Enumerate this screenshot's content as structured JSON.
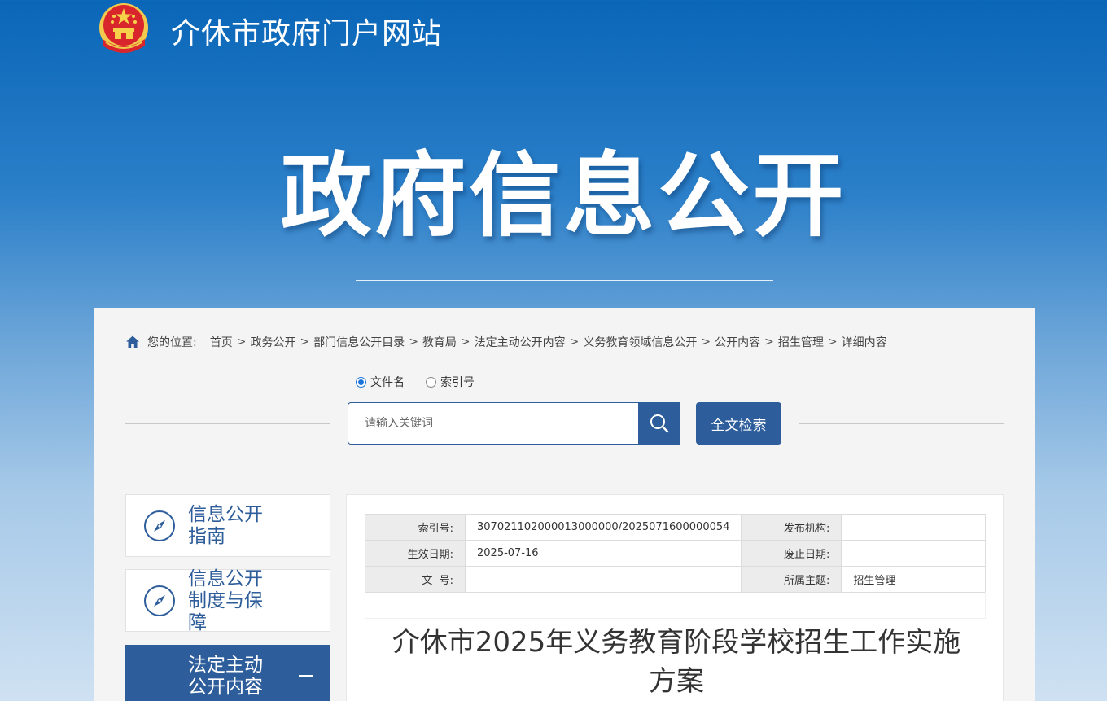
{
  "header": {
    "site_title": "介休市政府门户网站",
    "banner_title": "政府信息公开",
    "emblem_icon": "national-emblem-icon"
  },
  "breadcrumb": {
    "prefix": "您的位置:",
    "items": [
      "首页",
      "政务公开",
      "部门信息公开目录",
      "教育局",
      "法定主动公开内容",
      "义务教育领域信息公开",
      "公开内容",
      "招生管理",
      "详细内容"
    ]
  },
  "search": {
    "radio_options": [
      {
        "label": "文件名",
        "checked": true
      },
      {
        "label": "索引号",
        "checked": false
      }
    ],
    "placeholder": "请输入关键词",
    "fulltext_label": "全文检索"
  },
  "sidebar": {
    "items": [
      {
        "label": "信息公开指南",
        "active": false
      },
      {
        "label": "信息公开制度与保障",
        "active": false
      },
      {
        "label": "法定主动公开内容",
        "active": true
      }
    ]
  },
  "meta": {
    "rows": [
      {
        "k1": "索引号:",
        "v1": "307021102000013000000/2025071600000054",
        "k2": "发布机构:",
        "v2": ""
      },
      {
        "k1": "生效日期:",
        "v1": "2025-07-16",
        "k2": "废止日期:",
        "v2": ""
      },
      {
        "k1": "文  号:",
        "v1": "",
        "k2": "所属主题:",
        "v2": "招生管理"
      }
    ]
  },
  "article": {
    "title": "介休市2025年义务教育阶段学校招生工作实施方案"
  },
  "colors": {
    "primary": "#2d5d9a",
    "header_top": "#0a66b8",
    "panel_bg": "#f4f4f4"
  }
}
